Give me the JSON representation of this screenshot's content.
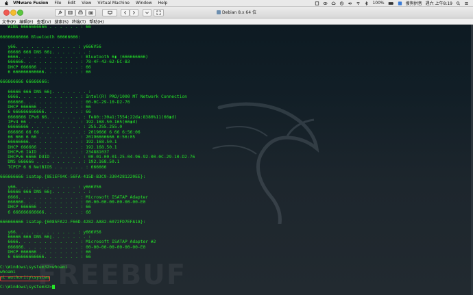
{
  "mac_menubar": {
    "app_name": "VMware Fusion",
    "menus": [
      "File",
      "Edit",
      "View",
      "Virtual Machine",
      "Window",
      "Help"
    ],
    "battery": "100%",
    "input_method": "搜狗拼音",
    "datetime": "週六 上午8:19"
  },
  "vm_window": {
    "title": "Debian 8.x 64 位",
    "toolbar_icons": [
      "wrench-icon",
      "disk-icon",
      "printer-icon",
      "camera-icon",
      "display-icon",
      "arrow-left-icon",
      "arrow-right-icon",
      "arrow-down-icon",
      "fullscreen-icon"
    ]
  },
  "console": {
    "menu": [
      "文件(F)",
      "编辑(E)",
      "查看(V)",
      "搜索(S)",
      "终端(T)",
      "帮助(H)"
    ],
    "lines": [
      "   WINS 6666666666 . . . . . . : 66",
      "",
      "66666666666 Bluetooth 66666666:",
      "",
      "   y66. . . . . . . . . . . . : y666V56",
      "   66666 666 DNS 66▯. . . . . . . :",
      "   6666. . . . . . . . . . . . : Bluetooth 6▮ (666666666)",
      "   666666. . . . . . . . . . . : 78-4F-43-62-EC-B3",
      "   DHCP 666666 . . . . . . . . : 66",
      "   6 666666666666. . . . . . . : 66",
      "",
      "666666666 66666666:",
      "",
      "   66666 666 DNS 66▯. . . . . . . :",
      "   6666. . . . . . . . . . . . : Intel(R) PRO/1000 MT Network Connection",
      "   666666. . . . . . . . . . . : 00-0C-29-10-D2-76",
      "   DHCP 666666 . . . . . . . . : 66",
      "   6 666666666666. . . . . . . : 66",
      "   6666666 IPv6 66. . . . . . . : fe80::30a1:7554:22da:8380%11(66▮d)",
      "   IPv4 66 . . . . . . . . . . : 192.168.50.165(66▮d)",
      "   66666666 . . . . . . . . . . : 255.255.255.0",
      "   666666 66 66 . . . . . . . . : 2019666 6 66 6:56:06",
      "   66 666 6 66 . . . . . . . . : 20196666666 6:56:05",
      "   66666666. . . . . . . . . . : 192.168.50.1",
      "   DHCP 666666 . . . . . . . . : 192.168.50.1",
      "   DHCPv6 IAID . . . . . . . . : 234881037",
      "   DHCPv6 6666 DUID . . . . . . : 00-01-00-01-25-04-96-92-00-0C-29-10-D2-76",
      "   DNS 666666 . . . . . . . . . : 192.168.50.1",
      "   TCPIP 6 6 NetBIOS . . . . . . : 666666",
      "",
      "666666666 isatap.{8E1EF04C-56FA-415D-B3C9-3304281220EE}:",
      "",
      "   y66. . . . . . . . . . . . : y666V56",
      "   66666 666 DNS 66▯. . . . . . . :",
      "   6666. . . . . . . . . . . . : Microsoft ISATAP Adapter",
      "   666666. . . . . . . . . . . : 00-00-00-00-00-00-00-E0",
      "   DHCP 666666 . . . . . . . . : 66",
      "   6 666666666666. . . . . . . : 66",
      "",
      "666666666 isatap.{6085FA22-F66D-4282-AA82-6072FD7EFA1A}:",
      "",
      "   y66. . . . . . . . . . . . : y666V56",
      "   66666 666 DNS 66▯. . . . . . . :",
      "   6666. . . . . . . . . . . . : Microsoft ISATAP Adapter #2",
      "   666666. . . . . . . . . . . : 00-00-00-00-00-00-00-E0",
      "   DHCP 666666 . . . . . . . . : 66",
      "   6 666666666666. . . . . . . : 66",
      "",
      "C:\\Windows\\system32>whoami",
      "whoami",
      "nt authority\\system",
      "",
      "C:\\Windows\\system32>"
    ],
    "watermark": "FREEBUF",
    "colors": {
      "text": "#24e628",
      "highlight_box": "#e53935"
    }
  }
}
